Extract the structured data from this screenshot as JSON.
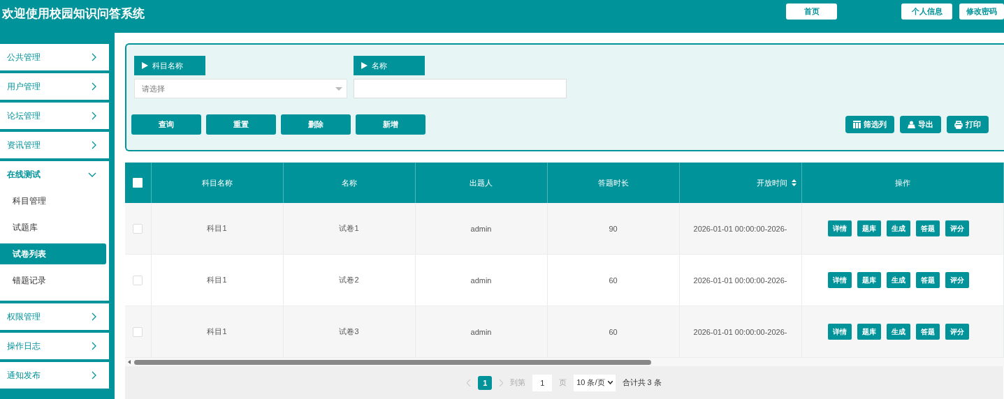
{
  "header": {
    "title": "欢迎使用校园知识问答系统",
    "nav_buttons": [
      "首页",
      "个人信息",
      "修改密码"
    ]
  },
  "sidebar": {
    "items": [
      {
        "label": "公共管理",
        "expanded": false
      },
      {
        "label": "用户管理",
        "expanded": false
      },
      {
        "label": "论坛管理",
        "expanded": false
      },
      {
        "label": "资讯管理",
        "expanded": false
      },
      {
        "label": "在线测试",
        "expanded": true,
        "children": [
          {
            "label": "科目管理",
            "selected": false
          },
          {
            "label": "试题库",
            "selected": false
          },
          {
            "label": "试卷列表",
            "selected": true
          },
          {
            "label": "错题记录",
            "selected": false
          }
        ]
      },
      {
        "label": "权限管理",
        "expanded": false
      },
      {
        "label": "操作日志",
        "expanded": false
      },
      {
        "label": "通知发布",
        "expanded": false
      }
    ]
  },
  "search": {
    "fields": [
      {
        "label": "科目名称",
        "kind": "select",
        "placeholder": "请选择"
      },
      {
        "label": "名称",
        "kind": "text"
      }
    ],
    "actions": [
      "查询",
      "重置",
      "删除",
      "新增"
    ],
    "tools": [
      {
        "label": "筛选列",
        "kind": "columns"
      },
      {
        "label": "导出",
        "kind": "export"
      },
      {
        "label": "打印",
        "kind": "print"
      }
    ]
  },
  "table": {
    "header_checked": false,
    "columns": [
      {
        "label": "科目名称"
      },
      {
        "label": "名称"
      },
      {
        "label": "出题人"
      },
      {
        "label": "答题时长"
      },
      {
        "label": "开放时间",
        "sortable": true
      },
      {
        "label": "操作"
      }
    ],
    "rows": [
      {
        "checked": false,
        "cells": [
          "科目1",
          "试卷1",
          "admin",
          "90",
          "2026-01-01 00:00:00-2026-"
        ],
        "actions": [
          "详情",
          "题库",
          "生成",
          "答题",
          "评分"
        ]
      },
      {
        "checked": false,
        "cells": [
          "科目1",
          "试卷2",
          "admin",
          "60",
          "2026-01-01 00:00:00-2026-"
        ],
        "actions": [
          "详情",
          "题库",
          "生成",
          "答题",
          "评分"
        ]
      },
      {
        "checked": false,
        "cells": [
          "科目1",
          "试卷3",
          "admin",
          "60",
          "2026-01-01 00:00:00-2026-"
        ],
        "actions": [
          "详情",
          "题库",
          "生成",
          "答题",
          "评分"
        ]
      }
    ]
  },
  "pagination": {
    "pages": [
      {
        "label": "1",
        "selected": true
      }
    ],
    "goto_label": "到第",
    "goto_value": "1",
    "page_suffix": "页",
    "page_size": "10 条/页",
    "total": "合计共 3 条"
  }
}
